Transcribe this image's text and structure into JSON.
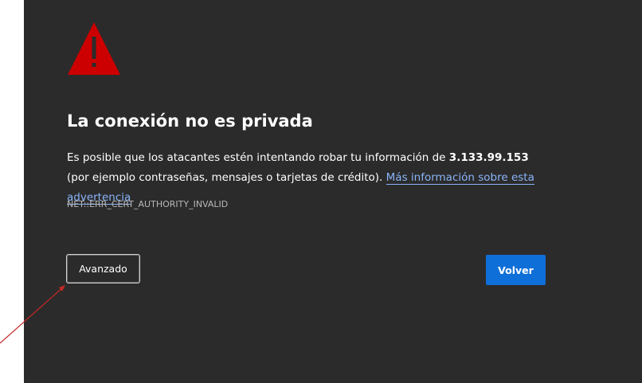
{
  "interstitial": {
    "title": "La conexión no es privada",
    "description_before": "Es posible que los atacantes estén intentando robar tu información de ",
    "host": "3.133.99.153",
    "description_after": " (por ejemplo contraseñas, mensajes o tarjetas de crédito). ",
    "learn_more_link": "Más información sobre esta advertencia",
    "error_code": "NET::ERR_CERT_AUTHORITY_INVALID",
    "icon": "warning-triangle-icon"
  },
  "buttons": {
    "advanced_label": "Avanzado",
    "back_label": "Volver"
  },
  "colors": {
    "background": "#2b2b2b",
    "warning_red": "#cc0000",
    "primary_button": "#0f6fd8",
    "link": "#8ab4f8",
    "annotation_arrow": "#c62828"
  }
}
